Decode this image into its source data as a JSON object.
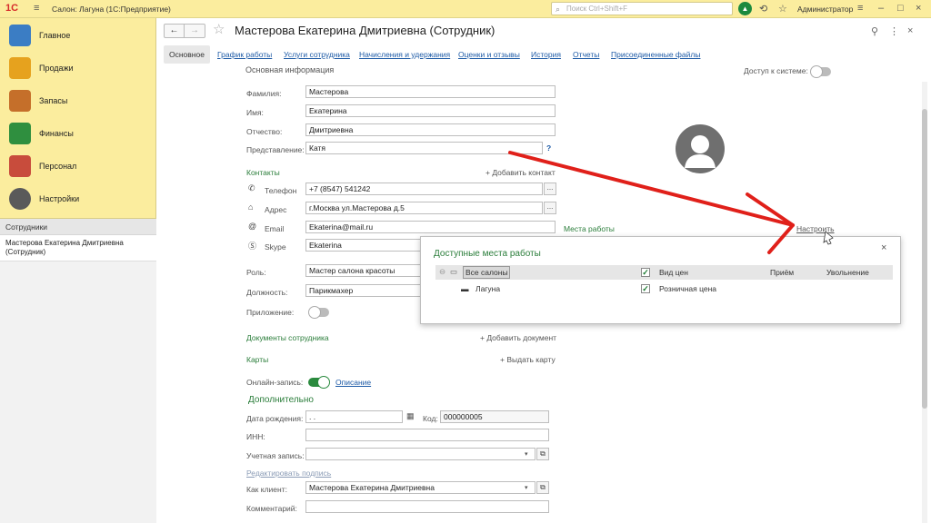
{
  "topbar": {
    "app_title": "Салон: Лагуна  (1С:Предприятие)",
    "search_placeholder": "Поиск Ctrl+Shift+F",
    "user": "Администратор",
    "logo": "1С"
  },
  "sidebar": {
    "items": [
      {
        "label": "Главное",
        "icon": "clipboard-icon",
        "color": "#3b7dc4"
      },
      {
        "label": "Продажи",
        "icon": "chart-icon",
        "color": "#e6a21e"
      },
      {
        "label": "Запасы",
        "icon": "boxes-icon",
        "color": "#c56f2a"
      },
      {
        "label": "Финансы",
        "icon": "wallet-icon",
        "color": "#2f8f3f"
      },
      {
        "label": "Персонал",
        "icon": "people-icon",
        "color": "#c84c3c"
      },
      {
        "label": "Настройки",
        "icon": "gear-icon",
        "color": "#5a5a5a"
      }
    ],
    "open_section": "Сотрудники",
    "open_item": "Мастерова Екатерина Дмитриевна (Сотрудник)"
  },
  "document": {
    "title": "Мастерова Екатерина Дмитриевна (Сотрудник)",
    "tabs": [
      "Основное",
      "График работы",
      "Услуги сотрудника",
      "Начисления и удержания",
      "Оценки и отзывы",
      "История",
      "Отчеты",
      "Присоединенные файлы"
    ]
  },
  "form": {
    "section_main": "Основная информация",
    "system_access": "Доступ к системе:",
    "last_name_label": "Фамилия:",
    "last_name": "Мастерова",
    "first_name_label": "Имя:",
    "first_name": "Екатерина",
    "patronymic_label": "Отчество:",
    "patronymic": "Дмитриевна",
    "display_label": "Представление:",
    "display": "Катя",
    "help": "?",
    "contacts": "Контакты",
    "add_contact": "+ Добавить контакт",
    "phone_label": "Телефон",
    "phone": "+7 (8547) 541242",
    "address_label": "Адрес",
    "address": "г.Москва ул.Мастерова д.5",
    "email_label": "Email",
    "email": "Ekaterina@mail.ru",
    "skype_label": "Skype",
    "skype": "Ekaterina",
    "dots": "...",
    "workplaces": "Места работы",
    "configure": "Настроить",
    "role_label": "Роль:",
    "role": "Мастер салона красоты",
    "position_label": "Должность:",
    "position": "Парикмахер",
    "app_label": "Приложение:",
    "documents": "Документы сотрудника",
    "add_document": "+ Добавить документ",
    "cards": "Карты",
    "issue_card": "+ Выдать карту",
    "online_label": "Онлайн-запись:",
    "description": "Описание",
    "additional": "Дополнительно",
    "birth_label": "Дата рождения:",
    "birth": " .  .",
    "code_label": "Код:",
    "code": "000000005",
    "inn_label": "ИНН:",
    "account_label": "Учетная запись:",
    "edit_signature": "Редактировать подпись",
    "client_label": "Как клиент:",
    "client": "Мастерова Екатерина Дмитриевна",
    "comment_label": "Комментарий:"
  },
  "popup": {
    "title": "Доступные места работы",
    "close": "×",
    "columns": [
      "Все салоны",
      "Вид цен",
      "Приём",
      "Увольнение"
    ],
    "rows": [
      {
        "name": "Лагуна",
        "price_type": "Розничная цена",
        "price_checked": true
      }
    ],
    "header_checked": true
  },
  "colors": {
    "accent": "#2a7d3a",
    "topbar": "#fbed9e",
    "link": "#1d5aa6",
    "arrow": "#e0201a"
  }
}
